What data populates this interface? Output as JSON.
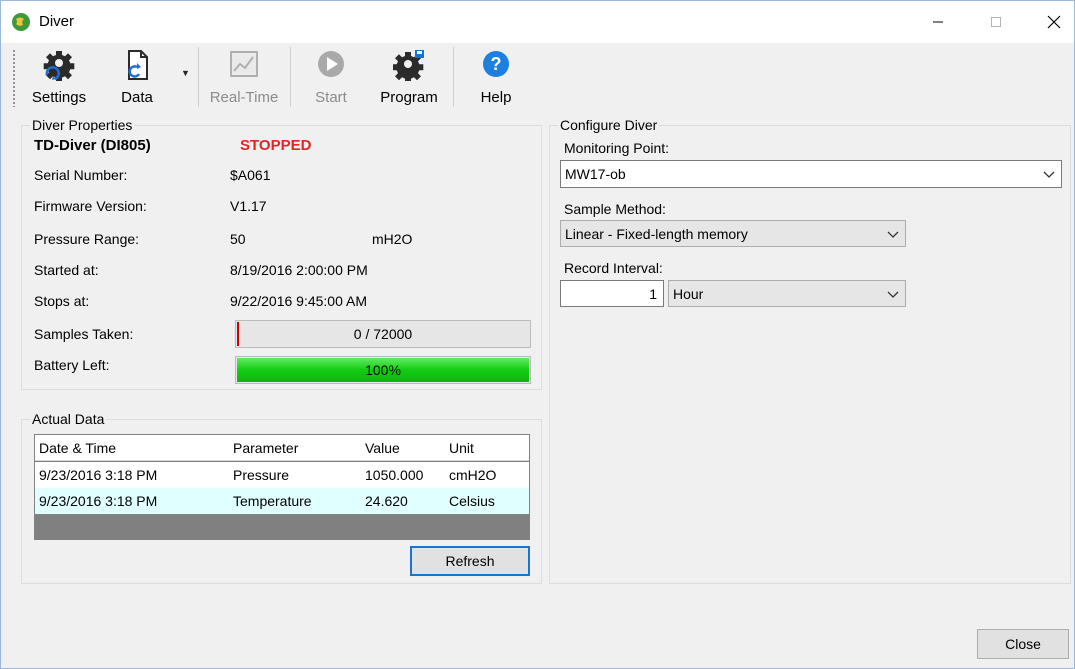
{
  "window": {
    "title": "Diver"
  },
  "toolbar": {
    "settings": "Settings",
    "data": "Data",
    "realtime": "Real-Time",
    "start": "Start",
    "program": "Program",
    "help": "Help"
  },
  "properties": {
    "group_title": "Diver Properties",
    "device_name": "TD-Diver (DI805)",
    "status": "STOPPED",
    "serial_label": "Serial Number:",
    "serial_value": "$A061",
    "firmware_label": "Firmware Version:",
    "firmware_value": "V1.17",
    "pressure_label": "Pressure Range:",
    "pressure_value": "50",
    "pressure_unit": "mH2O",
    "started_label": "Started at:",
    "started_value": "8/19/2016 2:00:00 PM",
    "stops_label": "Stops at:",
    "stops_value": "9/22/2016 9:45:00 AM",
    "samples_label": "Samples Taken:",
    "samples_text": "0 / 72000",
    "samples_fraction": 0.0,
    "battery_label": "Battery Left:",
    "battery_text": "100%",
    "battery_fraction": 1.0
  },
  "actual_data": {
    "group_title": "Actual Data",
    "columns": [
      "Date & Time",
      "Parameter",
      "Value",
      "Unit"
    ],
    "rows": [
      [
        "9/23/2016 3:18 PM",
        "Pressure",
        "1050.000",
        "cmH2O"
      ],
      [
        "9/23/2016 3:18 PM",
        "Temperature",
        "24.620",
        "Celsius"
      ]
    ],
    "refresh_label": "Refresh"
  },
  "configure": {
    "group_title": "Configure Diver",
    "monitoring_label": "Monitoring Point:",
    "monitoring_value": "MW17-ob",
    "method_label": "Sample Method:",
    "method_value": "Linear - Fixed-length memory",
    "interval_label": "Record Interval:",
    "interval_value": "1",
    "interval_unit": "Hour"
  },
  "footer": {
    "close_label": "Close"
  }
}
